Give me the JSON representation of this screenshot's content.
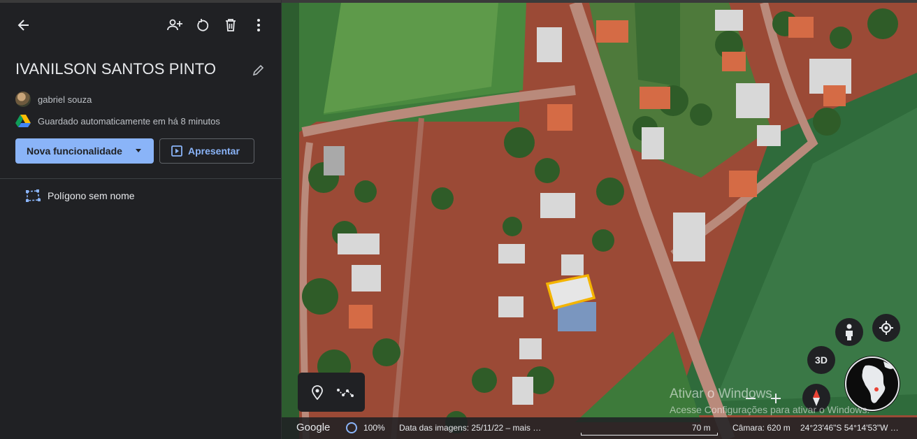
{
  "panel": {
    "title": "IVANILSON SANTOS PINTO",
    "owner_name": "gabriel souza",
    "saved_status": "Guardado automaticamente em há 8 minutos",
    "new_feature_label": "Nova funcionalidade",
    "present_label": "Apresentar",
    "features": [
      {
        "label": "Polígono sem nome",
        "icon": "polygon-icon"
      }
    ],
    "colors": {
      "accent": "#8ab4f8",
      "background": "#202124"
    }
  },
  "map": {
    "view_3d_label": "3D",
    "watermark_title": "Ativar o Windows",
    "watermark_sub": "Acesse Configurações para ativar o Windows.",
    "polygon_color": "#f4b400"
  },
  "status_bar": {
    "logo": "Google",
    "zoom": "100%",
    "imagery_date": "Data das imagens: 25/11/22 – mais …",
    "scale_label": "70 m",
    "camera": "Câmara: 620 m",
    "coordinates": "24°23'46\"S 54°14'53\"W …"
  }
}
